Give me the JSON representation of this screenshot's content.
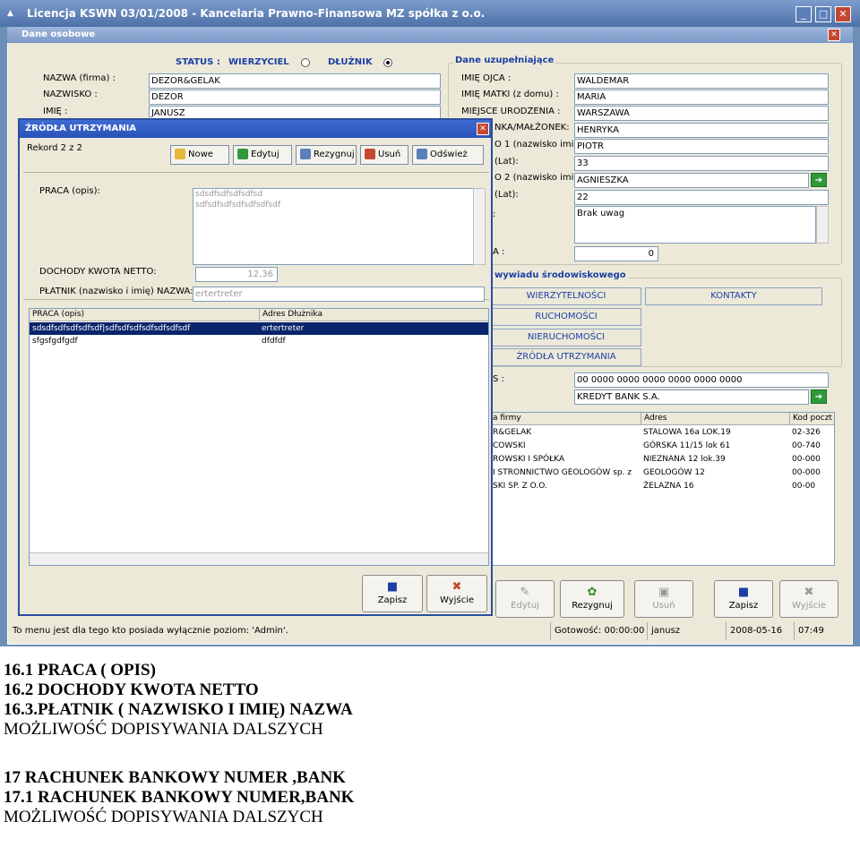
{
  "window": {
    "title": "Licencja KSWN 03/01/2008 - Kancelaria Prawno-Finansowa MZ spółka z o.o.",
    "minimize": "_",
    "maximize": "□",
    "close": "✕"
  },
  "form": {
    "title": "Dane osobowe",
    "status_label": "STATUS :",
    "status_creditor": "WIERZYCIEL",
    "status_debtor": "DŁUŻNIK",
    "name_label": "NAZWA (firma) :",
    "name_value": "DEZOR&GELAK",
    "surname_label": "NAZWISKO :",
    "surname_value": "DEZOR",
    "firstname_label": "IMIĘ :",
    "firstname_value": "JANUSZ",
    "extra_group": "Dane uzupełniające",
    "father_label": "IMIĘ OJCA :",
    "father_value": "WALDEMAR",
    "mother_label": "IMIĘ MATKI (z domu) :",
    "mother_value": "MARIA",
    "birthplace_label": "MIEJSCE URODZENIA :",
    "birthplace_value": "WARSZAWA",
    "spouse_label": "NKA/MAŁŻONEK:",
    "spouse_value": "HENRYKA",
    "child1_label": "O 1 (nazwisko imię):",
    "child1_value": "PIOTR",
    "age1_label": "(Lat):",
    "age1_value": "33",
    "child2_label": "O 2 (nazwisko imię):",
    "child2_value": "AGNIESZKA",
    "age2_label": "(Lat):",
    "age2_value": "22",
    "notes_value": "Brak uwag",
    "notes_label": ":",
    "count_label": "A :",
    "count_value": "0",
    "interview_group": "wywiadu środowiskowego",
    "btn_claims": "WIERZYTELNOŚCI",
    "btn_contacts": "KONTAKTY",
    "btn_movables": "RUCHOMOŚCI",
    "btn_realestate": "NIERUCHOMOŚCI",
    "btn_income": "ŹRÓDŁA UTRZYMANIA",
    "account_label": "S :",
    "account_value": "00 0000 0000 0000 0000 0000 0000",
    "bank_value": "KREDYT BANK S.A.",
    "table_headers": [
      "a firmy",
      "Adres",
      "Kod poczt"
    ],
    "table_rows": [
      [
        "R&GELAK",
        "STALOWA 16a LOK.19",
        "02-326"
      ],
      [
        "COWSKI",
        "GÓRSKA 11/15 lok 61",
        "00-740"
      ],
      [
        "ROWSKI I SPÓŁKA",
        "NIEZNANA 12 lok.39",
        "00-000"
      ],
      [
        "I STRONNICTWO GEOLOGÓW sp. z",
        "GEOLOGÓW 12",
        "00-000"
      ],
      [
        "SKI SP. Z O.O.",
        "ŻELAZNA 16",
        "00-00"
      ]
    ],
    "bottom_buttons": {
      "edit": "Edytuj",
      "cancel": "Rezygnuj",
      "delete": "Usuń",
      "save": "Zapisz",
      "exit": "Wyjście"
    }
  },
  "dialog": {
    "title": "ŹRÓDŁA UTRZYMANIA",
    "record": "Rekord 2 z 2",
    "toolbar": {
      "new": "Nowe",
      "edit": "Edytuj",
      "cancel": "Rezygnuj",
      "delete": "Usuń",
      "refresh": "Odśwież"
    },
    "work_label": "PRACA (opis):",
    "work_lines": [
      "sdsdfsdfsdfsdfsd",
      "sdfsdfsdfsdfsdfsdfsdf"
    ],
    "income_label": "DOCHODY KWOTA NETTO:",
    "income_value": "12,36",
    "payer_label": "PŁATNIK (nazwisko i imię) NAZWA:",
    "payer_value": "ertertreter",
    "grid_headers": [
      "PRACA (opis)",
      "Adres Dłużnika"
    ],
    "grid_rows": [
      [
        "sdsdfsdfsdfsdfsdf|sdfsdfsdfsdfsdfsdfsdf",
        "ertertreter"
      ],
      [
        "sfgsfgdfgdf",
        "dfdfdf"
      ]
    ],
    "save": "Zapisz",
    "exit": "Wyjście"
  },
  "statusbar": {
    "message": "To menu jest dla tego kto posiada wyłącznie poziom: 'Admin'.",
    "ready": "Gotowość: 00:00:00",
    "user": "janusz",
    "date": "2008-05-16",
    "time": "07:49"
  },
  "doc_lines": [
    "16.1 PRACA ( OPIS)",
    "16.2 DOCHODY KWOTA NETTO",
    "16.3.PŁATNIK ( NAZWISKO I IMIĘ) NAZWA",
    "MOŻLIWOŚĆ DOPISYWANIA DALSZYCH",
    "17 RACHUNEK BANKOWY NUMER ,BANK",
    "17.1 RACHUNEK BANKOWY NUMER,BANK",
    "MOŻLIWOŚĆ DOPISYWANIA DALSZYCH"
  ],
  "colors": {
    "accent": "#1c3fa6",
    "title": "#2a52b8",
    "selection": "#0a246a"
  }
}
